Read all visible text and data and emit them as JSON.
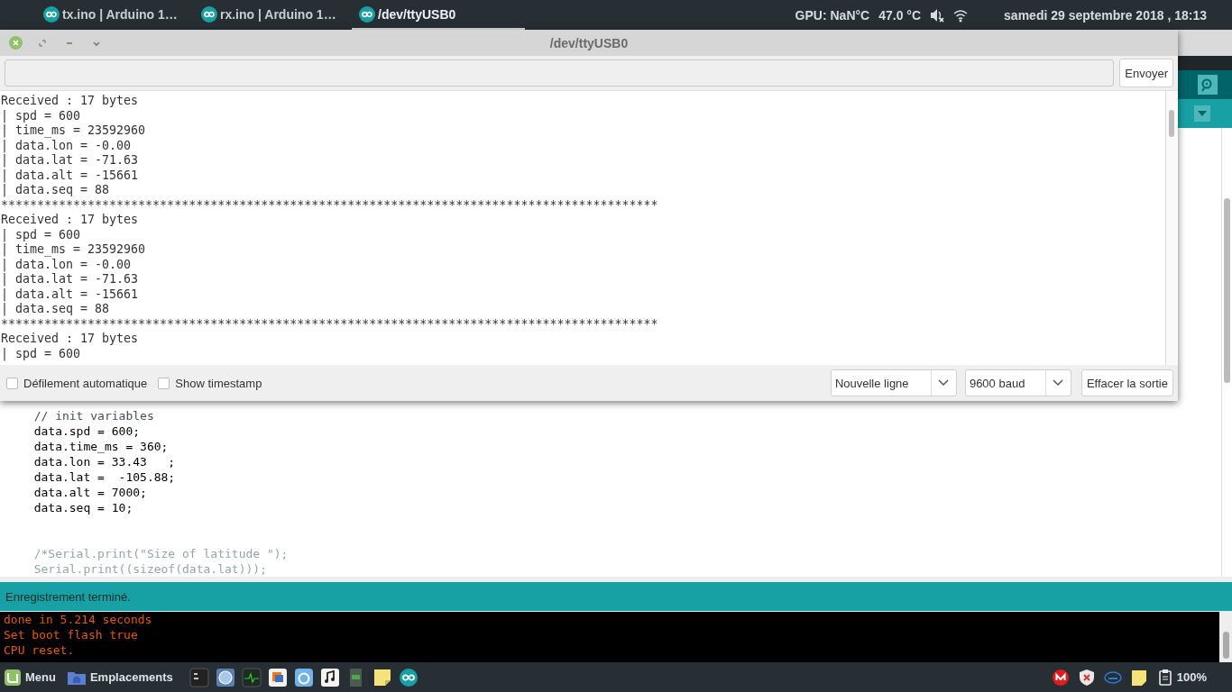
{
  "top_panel": {
    "tabs": [
      {
        "label": "tx.ino | Arduino 1…",
        "selected": false
      },
      {
        "label": "rx.ino | Arduino 1…",
        "selected": false
      },
      {
        "label": "/dev/ttyUSB0",
        "selected": true
      }
    ],
    "gpu": "GPU: NaN°C",
    "temperature": "47.0 °C",
    "clock": "samedi 29 septembre 2018 , 18:13"
  },
  "serial_window": {
    "title": "/dev/ttyUSB0",
    "send_button": "Envoyer",
    "output_lines": [
      "Received : 17 bytes",
      "| spd = 600",
      "| time_ms = 23592960",
      "| data.lon = -0.00",
      "| data.lat = -71.63",
      "| data.alt = -15661",
      "| data.seq = 88",
      "*******************************************************************************************",
      "Received : 17 bytes",
      "| spd = 600",
      "| time_ms = 23592960",
      "| data.lon = -0.00",
      "| data.lat = -71.63",
      "| data.alt = -15661",
      "| data.seq = 88",
      "*******************************************************************************************",
      "Received : 17 bytes",
      "| spd = 600"
    ],
    "autoscroll": {
      "label": "Défilement automatique",
      "checked": false
    },
    "timestamp": {
      "label": "Show timestamp",
      "checked": false
    },
    "line_ending": "Nouvelle ligne",
    "baud": "9600 baud",
    "clear_button": "Effacer la sortie"
  },
  "editor": {
    "lines": [
      {
        "kind": "comment",
        "text": "// init variables"
      },
      {
        "kind": "code",
        "text": "data.spd = 600;"
      },
      {
        "kind": "code",
        "text": "data.time_ms = 360;"
      },
      {
        "kind": "code",
        "text": "data.lon = 33.43   ;"
      },
      {
        "kind": "code",
        "text": "data.lat =  -105.88;"
      },
      {
        "kind": "code",
        "text": "data.alt = 7000;"
      },
      {
        "kind": "code",
        "text": "data.seq = 10;"
      },
      {
        "kind": "blank"
      },
      {
        "kind": "blank"
      },
      {
        "kind": "disabled",
        "text": "/*Serial.print(\"Size of latitude \");"
      },
      {
        "kind": "disabled",
        "text": "Serial.print((sizeof(data.lat)));"
      }
    ]
  },
  "status": "Enregistrement terminé.",
  "console": [
    "done in 5.214 seconds",
    "Set boot flash true",
    "CPU reset."
  ],
  "taskbar": {
    "menu": "Menu",
    "places": "Emplacements",
    "battery": "100%"
  }
}
